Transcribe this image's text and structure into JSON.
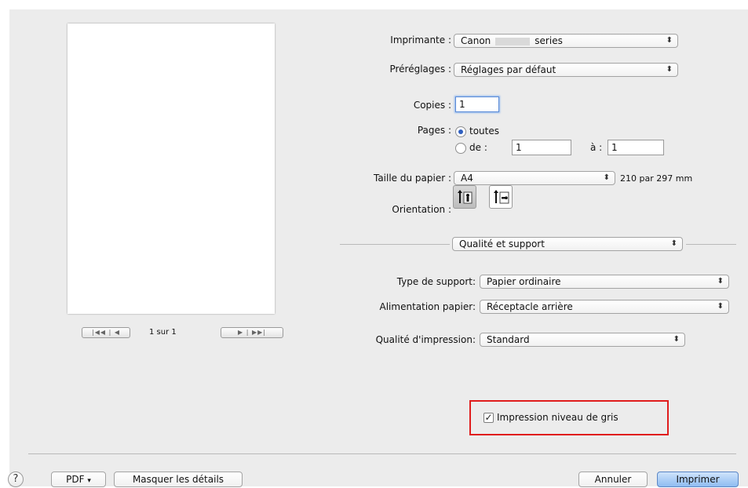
{
  "printer": {
    "label": "Imprimante :",
    "value_prefix": "Canon",
    "value_suffix": "series"
  },
  "presets": {
    "label": "Préréglages :",
    "value": "Réglages par défaut"
  },
  "copies": {
    "label": "Copies :",
    "value": "1"
  },
  "pages": {
    "label": "Pages :",
    "option_all": "toutes",
    "option_range": "de :",
    "from": "1",
    "to_label": "à :",
    "to": "1",
    "selected": "toutes"
  },
  "paper_size": {
    "label": "Taille du papier :",
    "value": "A4",
    "dimensions": "210 par 297 mm"
  },
  "orientation": {
    "label": "Orientation :",
    "selected": "portrait"
  },
  "section_popup": {
    "value": "Qualité et support"
  },
  "media_type": {
    "label": "Type de support:",
    "value": "Papier ordinaire"
  },
  "paper_source": {
    "label": "Alimentation papier:",
    "value": "Réceptacle arrière"
  },
  "print_quality": {
    "label": "Qualité d'impression:",
    "value": "Standard"
  },
  "grayscale": {
    "label": "Impression niveau de gris",
    "checked": true
  },
  "preview": {
    "page_indicator": "1 sur 1"
  },
  "footer": {
    "help": "?",
    "pdf": "PDF",
    "hide_details": "Masquer les détails",
    "cancel": "Annuler",
    "print": "Imprimer"
  },
  "colors": {
    "highlight": "#e01d1d",
    "default_button": "#8fbcf1",
    "radio_selected": "#2f5fbf"
  }
}
